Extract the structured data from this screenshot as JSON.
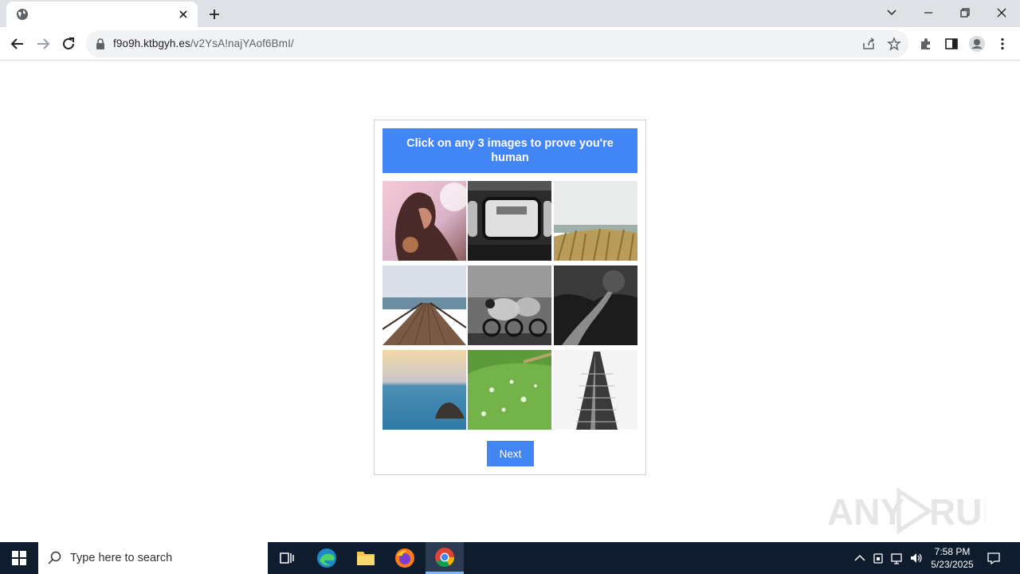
{
  "browser": {
    "tab_title": "",
    "url_host": "f9o9h.ktbgyh.es",
    "url_path": "/v2YsA!najYAof6BmI/"
  },
  "captcha": {
    "instruction": "Click on any 3 images to prove you're human",
    "next_label": "Next",
    "images": [
      "woman-silhouette-sunset",
      "vintage-train-window-bw",
      "dune-grass-beach",
      "wooden-pier-sea",
      "cyclists-motion-blur-bw",
      "forest-road-bw",
      "ocean-rock-sunset",
      "green-leaf-water-drops",
      "flatiron-building-bw"
    ]
  },
  "watermark": {
    "text": "ANY RUN"
  },
  "taskbar": {
    "search_placeholder": "Type here to search",
    "time": "7:58 PM",
    "date": "5/23/2025"
  },
  "colors": {
    "accent": "#4285f4",
    "taskbar": "#0f1c2e",
    "tabstrip": "#dee1e6"
  }
}
